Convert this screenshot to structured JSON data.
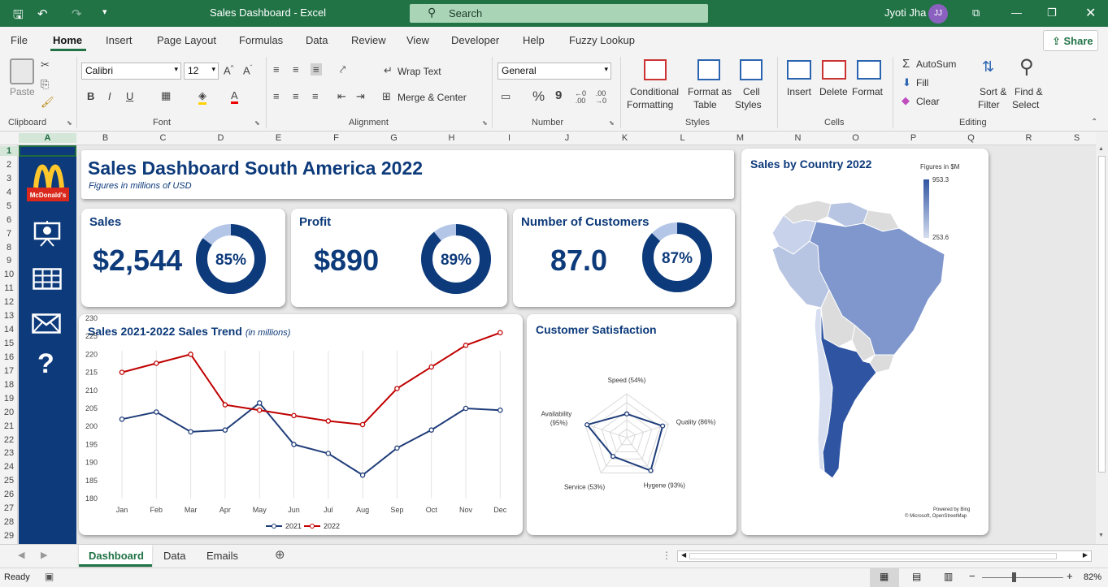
{
  "window": {
    "title": "Sales Dashboard  -  Excel",
    "search_placeholder": "Search",
    "user_name": "Jyoti Jha",
    "user_initials": "JJ"
  },
  "menu": {
    "tabs": [
      "File",
      "Home",
      "Insert",
      "Page Layout",
      "Formulas",
      "Data",
      "Review",
      "View",
      "Developer",
      "Help",
      "Fuzzy Lookup"
    ],
    "active": "Home",
    "share_label": "Share"
  },
  "ribbon": {
    "clipboard": {
      "paste": "Paste",
      "label": "Clipboard"
    },
    "font": {
      "name": "Calibri",
      "size": "12",
      "bold": "B",
      "italic": "I",
      "underline": "U",
      "label": "Font"
    },
    "alignment": {
      "wrap_text": "Wrap Text",
      "merge_center": "Merge & Center",
      "label": "Alignment"
    },
    "number": {
      "format": "General",
      "percent": "%",
      "comma": "9",
      "label": "Number"
    },
    "styles": {
      "conditional_formatting": [
        "Conditional",
        "Formatting"
      ],
      "format_as_table": [
        "Format as",
        "Table"
      ],
      "cell_styles": [
        "Cell",
        "Styles"
      ],
      "label": "Styles"
    },
    "cells": {
      "insert": "Insert",
      "delete": "Delete",
      "format": "Format",
      "label": "Cells"
    },
    "editing": {
      "autosum": "AutoSum",
      "fill": "Fill",
      "clear": "Clear",
      "sort_filter": [
        "Sort &",
        "Filter"
      ],
      "find_select": [
        "Find &",
        "Select"
      ],
      "label": "Editing"
    }
  },
  "columns": [
    "A",
    "B",
    "C",
    "D",
    "E",
    "F",
    "G",
    "H",
    "I",
    "J",
    "K",
    "L",
    "M",
    "N",
    "O",
    "P",
    "Q",
    "R",
    "S"
  ],
  "rows": [
    "1",
    "2",
    "3",
    "4",
    "5",
    "6",
    "7",
    "8",
    "9",
    "10",
    "11",
    "12",
    "13",
    "14",
    "15",
    "16",
    "17",
    "18",
    "19",
    "20",
    "21",
    "22",
    "23",
    "24",
    "25",
    "26",
    "27",
    "28",
    "29"
  ],
  "sidebar": {
    "logo_text": "McDonald's",
    "icons": [
      "presentation-icon",
      "table-icon",
      "mail-icon",
      "help-icon"
    ],
    "help_glyph": "?"
  },
  "dashboard": {
    "title": "Sales Dashboard South America 2022",
    "subtitle": "Figures in millions of USD",
    "kpis": [
      {
        "label": "Sales",
        "value": "$2,544",
        "percent": "85%",
        "fraction": 0.85
      },
      {
        "label": "Profit",
        "value": "$890",
        "percent": "89%",
        "fraction": 0.89
      },
      {
        "label": "Number of Customers",
        "value": "87.0",
        "percent": "87%",
        "fraction": 0.87
      }
    ],
    "trend": {
      "title": "Sales 2021-2022 Sales Trend",
      "title_note": "(in millions)"
    },
    "satisfaction": {
      "title": "Customer Satisfaction"
    },
    "map": {
      "title": "Sales by Country 2022",
      "legend_title": "Figures in $M",
      "legend_max": "953.3",
      "legend_min": "253.6",
      "credit1": "Powered by Bing",
      "credit2": "© Microsoft, OpenStreetMap"
    }
  },
  "chart_data": [
    {
      "type": "line",
      "title": "Sales 2021-2022 Sales Trend (in millions)",
      "categories": [
        "Jan",
        "Feb",
        "Mar",
        "Apr",
        "May",
        "Jun",
        "Jul",
        "Aug",
        "Sep",
        "Oct",
        "Nov",
        "Dec"
      ],
      "yticks": [
        180,
        185,
        190,
        195,
        200,
        205,
        210,
        215,
        220,
        225,
        230
      ],
      "ylim": [
        180,
        230
      ],
      "series": [
        {
          "name": "2021",
          "color": "#1f3d7a",
          "values": [
            202,
            204,
            198.5,
            199,
            206.5,
            195,
            192.5,
            186.5,
            194,
            199,
            205,
            204.5
          ]
        },
        {
          "name": "2022",
          "color": "#c00000",
          "values": [
            215,
            217.5,
            220,
            206,
            204.5,
            203,
            201.5,
            200.5,
            210.5,
            216.5,
            222.5,
            226
          ]
        }
      ],
      "legend": "bottom"
    },
    {
      "type": "radar",
      "title": "Customer Satisfaction",
      "categories": [
        "Speed (54%)",
        "Quality (86%)",
        "Hygene (93%)",
        "Service (53%)",
        "Availability (95%)"
      ],
      "values": [
        54,
        86,
        93,
        53,
        95
      ],
      "range": [
        0,
        100
      ]
    }
  ],
  "tabs": {
    "sheets": [
      "Dashboard",
      "Data",
      "Emails"
    ],
    "active": "Dashboard"
  },
  "status": {
    "ready": "Ready",
    "zoom": "82%"
  }
}
